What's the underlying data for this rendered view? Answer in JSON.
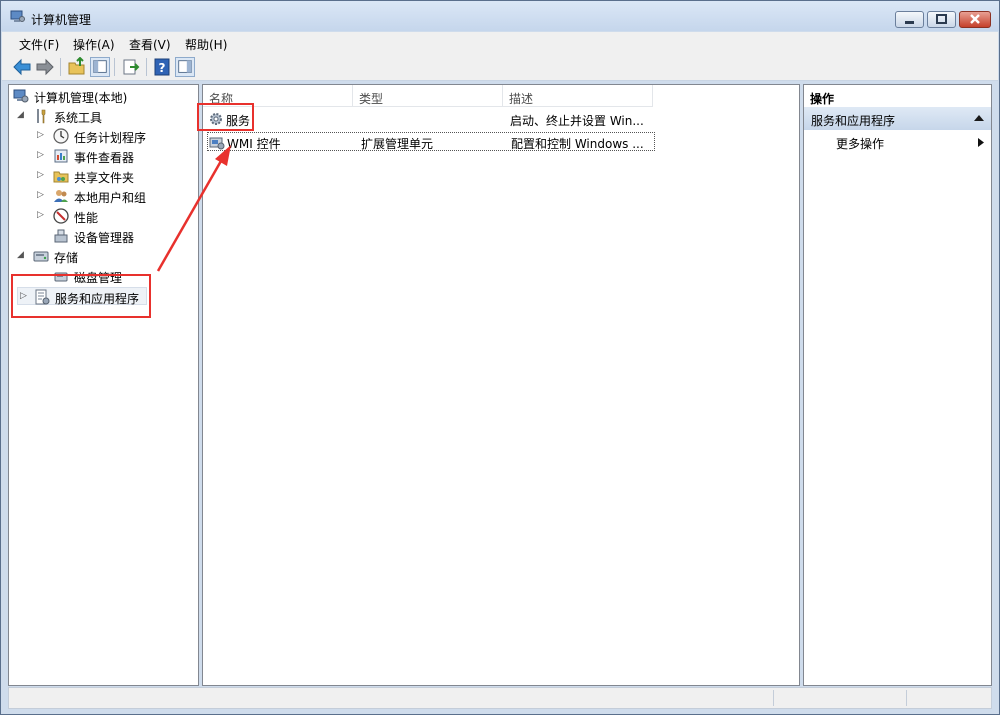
{
  "window": {
    "title": "计算机管理"
  },
  "menu": [
    "文件(F)",
    "操作(A)",
    "查看(V)",
    "帮助(H)"
  ],
  "toolbar": [
    "back-icon",
    "forward-icon",
    "up-folder-icon",
    "show-hide-tree-icon",
    "export-list-icon",
    "help-icon",
    "show-hide-action-pane-icon"
  ],
  "tree": {
    "root": "计算机管理(本地)",
    "system_tools": "系统工具",
    "task_scheduler": "任务计划程序",
    "event_viewer": "事件查看器",
    "shared_folders": "共享文件夹",
    "local_users": "本地用户和组",
    "performance": "性能",
    "device_manager": "设备管理器",
    "storage": "存储",
    "disk_management": "磁盘管理",
    "services_apps": "服务和应用程序"
  },
  "list": {
    "columns": [
      "名称",
      "类型",
      "描述"
    ],
    "rows": [
      {
        "name": "服务",
        "type": "",
        "desc": "启动、终止并设置 Win..."
      },
      {
        "name": "WMI 控件",
        "type": "扩展管理单元",
        "desc": "配置和控制 Windows ..."
      }
    ]
  },
  "actions": {
    "header": "操作",
    "section": "服务和应用程序",
    "more": "更多操作"
  },
  "colors": {
    "highlight": "#e8312d",
    "selection_bg": "#dfe9f5"
  }
}
